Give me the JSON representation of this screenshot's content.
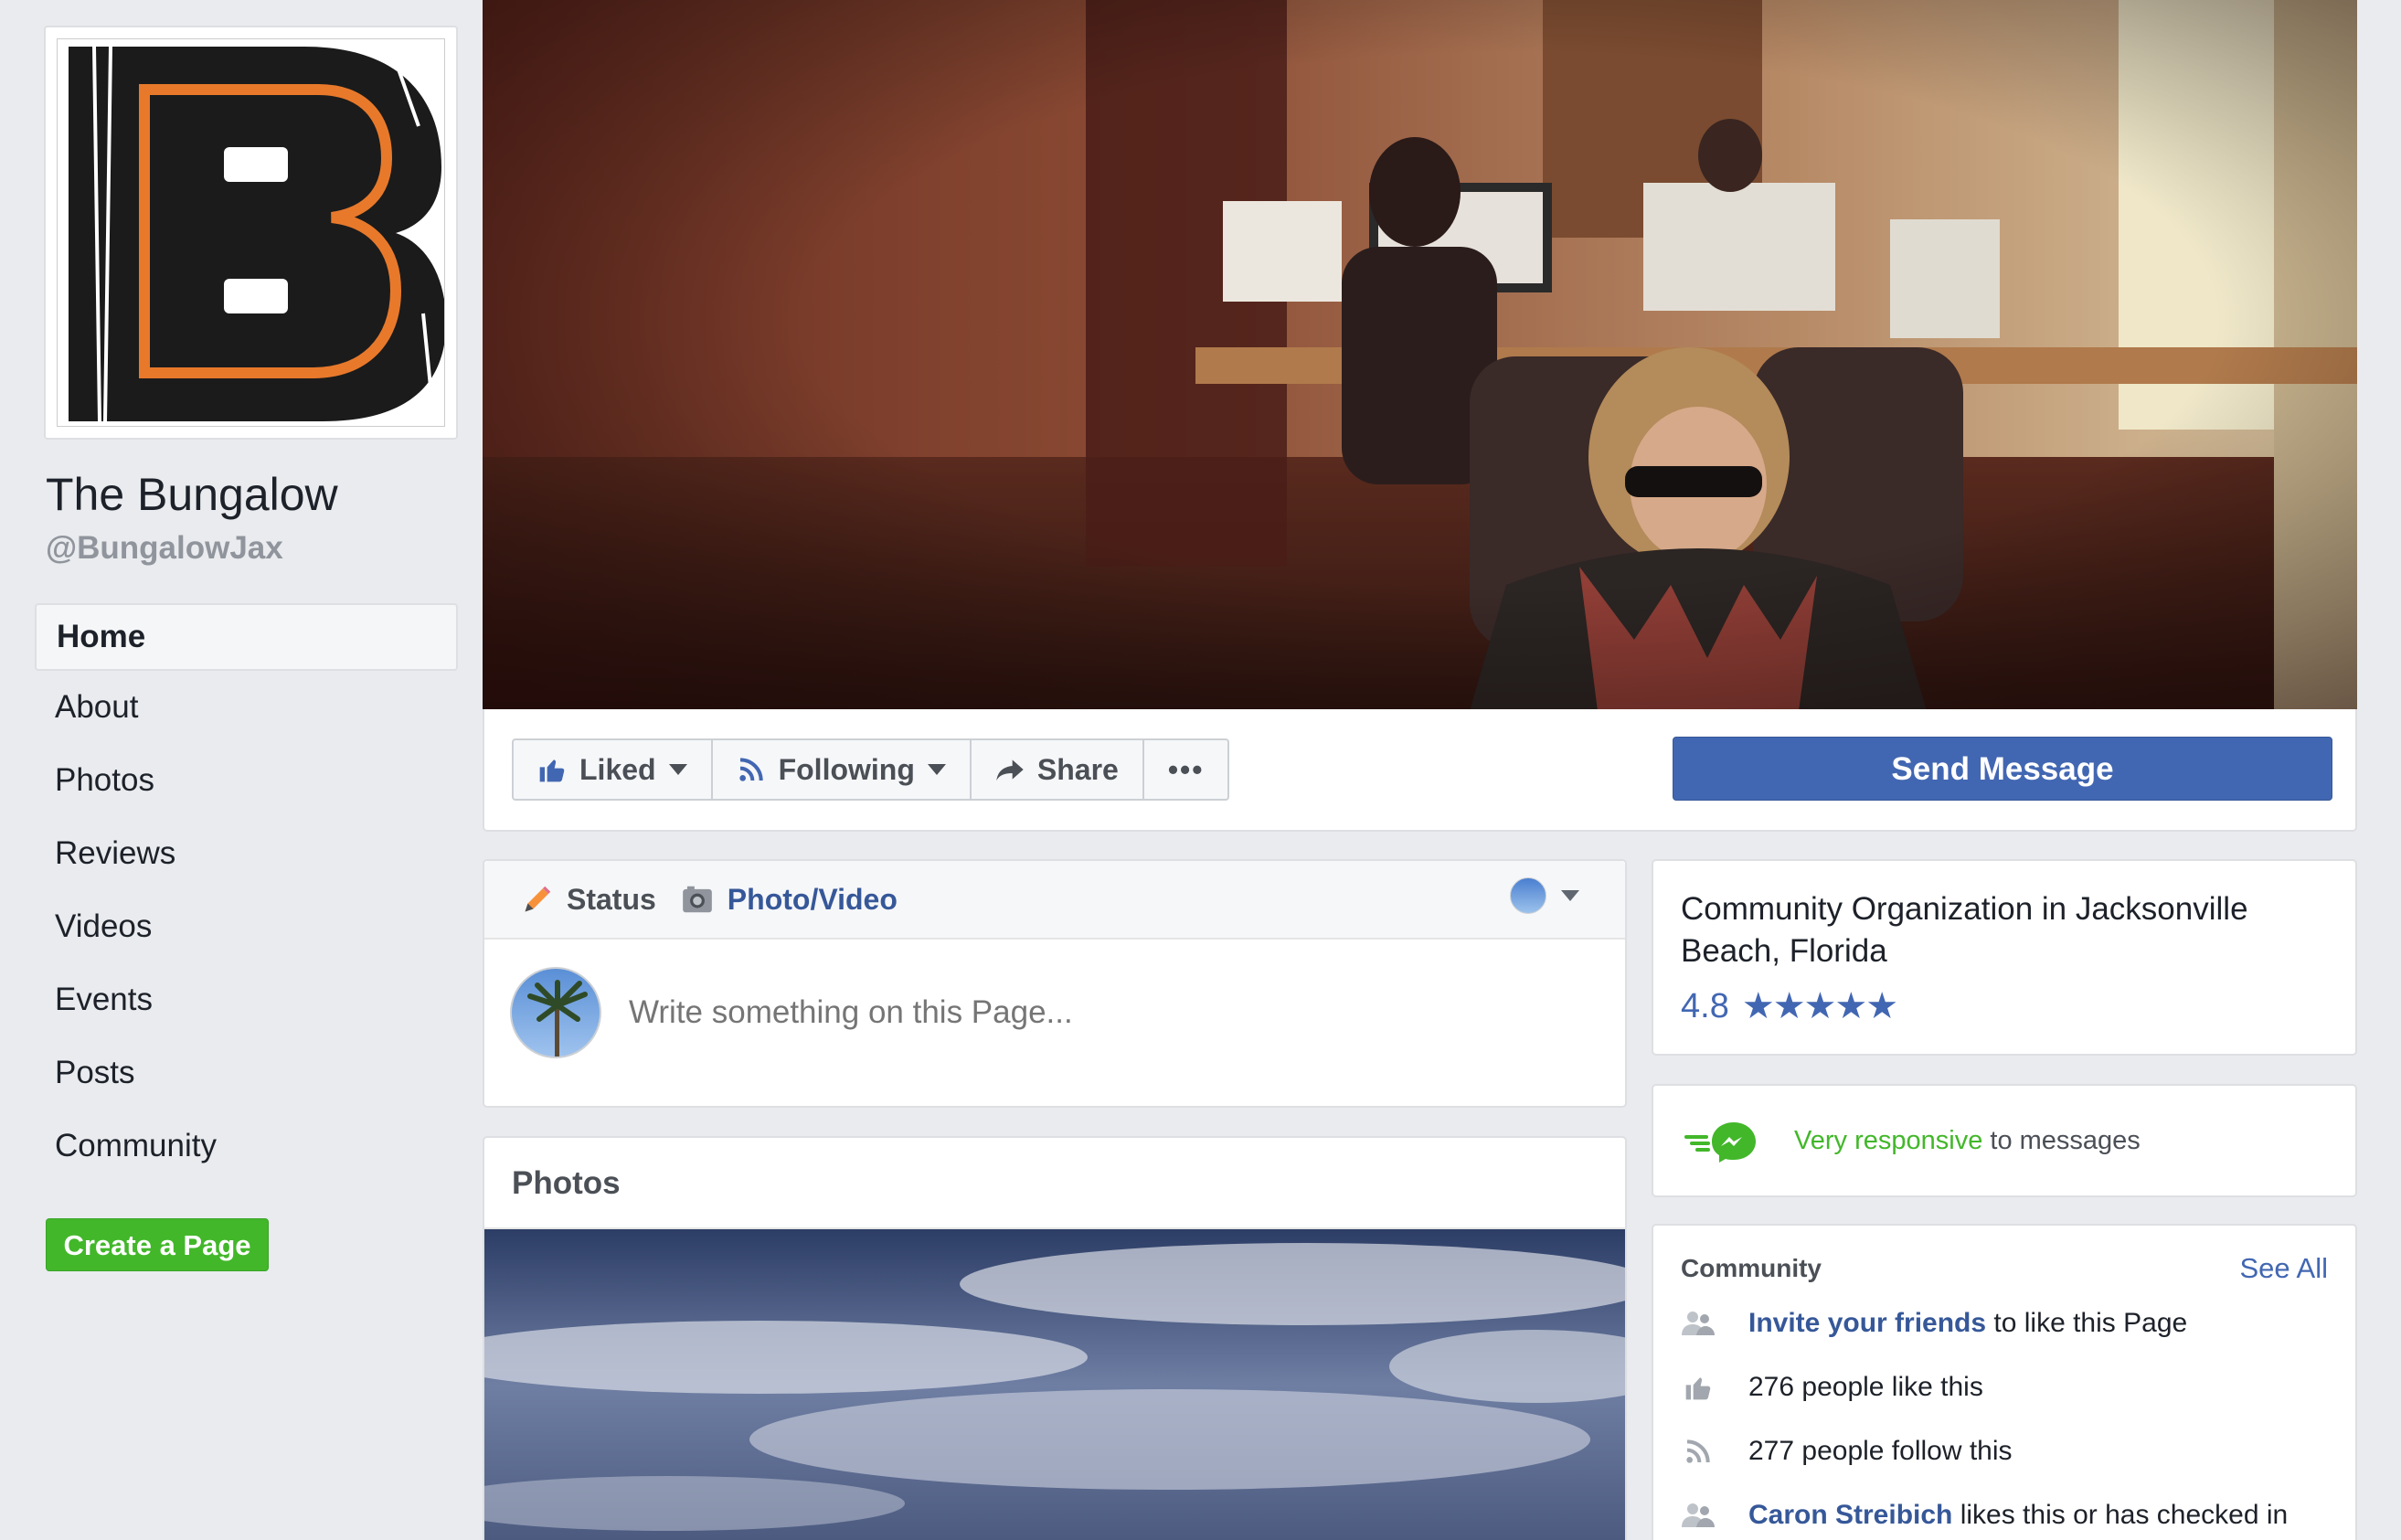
{
  "page": {
    "name": "The Bungalow",
    "handle": "@BungalowJax"
  },
  "nav": {
    "items": [
      "Home",
      "About",
      "Photos",
      "Reviews",
      "Videos",
      "Events",
      "Posts",
      "Community"
    ],
    "create_page": "Create a Page"
  },
  "actions": {
    "liked": "Liked",
    "following": "Following",
    "share": "Share",
    "more": "•••",
    "send_message": "Send Message"
  },
  "composer": {
    "tab_status": "Status",
    "tab_photo_video": "Photo/Video",
    "placeholder": "Write something on this Page..."
  },
  "photos": {
    "title": "Photos"
  },
  "about": {
    "category": "Community Organization in Jacksonville Beach, Florida",
    "rating": "4.8",
    "stars": "★★★★★"
  },
  "responsive": {
    "highlight": "Very responsive",
    "rest": " to messages"
  },
  "community": {
    "title": "Community",
    "see_all": "See All",
    "invite_link": "Invite your friends",
    "invite_rest": " to like this Page",
    "likes": "276 people like this",
    "follows": "277 people follow this",
    "checkin_name": "Caron Streibich",
    "checkin_rest": " likes this or has checked in"
  },
  "colors": {
    "brand_blue": "#4267b2",
    "green": "#42b72a",
    "logo_orange": "#e8792b",
    "logo_black": "#1b1b1b"
  }
}
